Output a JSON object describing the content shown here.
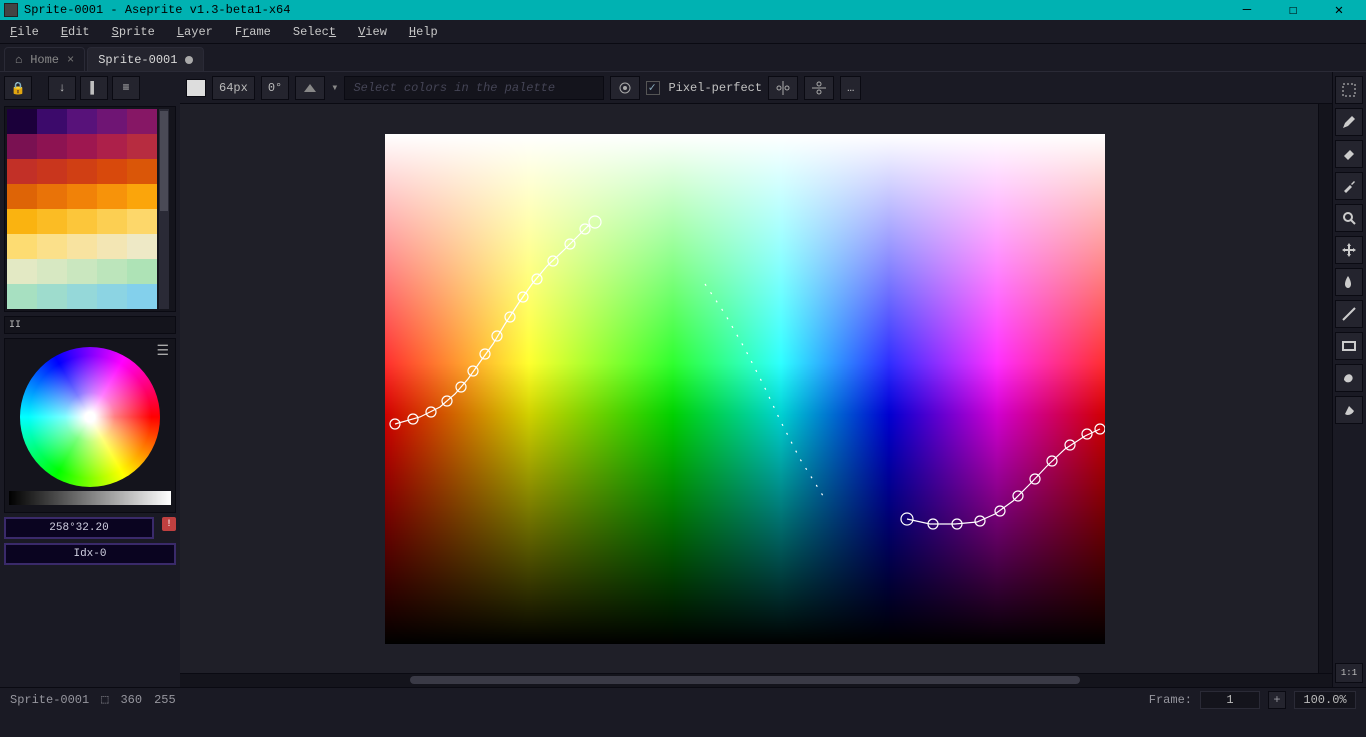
{
  "window": {
    "title": "Sprite-0001 - Aseprite v1.3-beta1-x64"
  },
  "menu": {
    "file": "File",
    "edit": "Edit",
    "sprite": "Sprite",
    "layer": "Layer",
    "frame": "Frame",
    "select": "Select",
    "view": "View",
    "help": "Help"
  },
  "tabs": {
    "home": {
      "label": "Home"
    },
    "sprite": {
      "label": "Sprite-0001",
      "dirty": true
    }
  },
  "options": {
    "brush_size": "64px",
    "angle": "0°",
    "palette_placeholder": "Select colors in the palette",
    "pixel_perfect_label": "Pixel-perfect",
    "pixel_perfect_checked": true
  },
  "palette": {
    "swatches": [
      "#1b003a",
      "#3c0a6b",
      "#58127a",
      "#6f1574",
      "#861765",
      "#7a1152",
      "#8d1352",
      "#9e1750",
      "#ad204a",
      "#b72c40",
      "#c23027",
      "#c9361d",
      "#d03f14",
      "#d8490c",
      "#da5608",
      "#de6406",
      "#e97308",
      "#f18208",
      "#f7930a",
      "#fba50b",
      "#fab310",
      "#fbbc24",
      "#fcc63a",
      "#fccf52",
      "#fdd76a",
      "#fddc72",
      "#fbe08a",
      "#f8e3a0",
      "#f3e6b4",
      "#eee9c6",
      "#e3e9c4",
      "#d7e8c2",
      "#cae7bf",
      "#bce5bb",
      "#aee3b6",
      "#a7e0c1",
      "#9edccd",
      "#95d8d9",
      "#8cd4e3",
      "#83d0ec"
    ],
    "footer": "II"
  },
  "position_display": "258°32.20",
  "index_display": "Idx-0",
  "status": {
    "filename": "Sprite-0001",
    "dims": "360",
    "extra": "255",
    "frame_label": "Frame:",
    "frame_value": "1",
    "zoom": "100.0%"
  },
  "tools": {
    "marquee": "marquee",
    "pencil": "pencil",
    "eraser": "eraser",
    "eyedropper": "eyedropper",
    "zoom": "zoom",
    "move": "move",
    "paint_bucket": "paint-bucket",
    "line": "line",
    "rect": "rect",
    "contour": "contour",
    "blur": "blur",
    "ratio": "1:1"
  }
}
